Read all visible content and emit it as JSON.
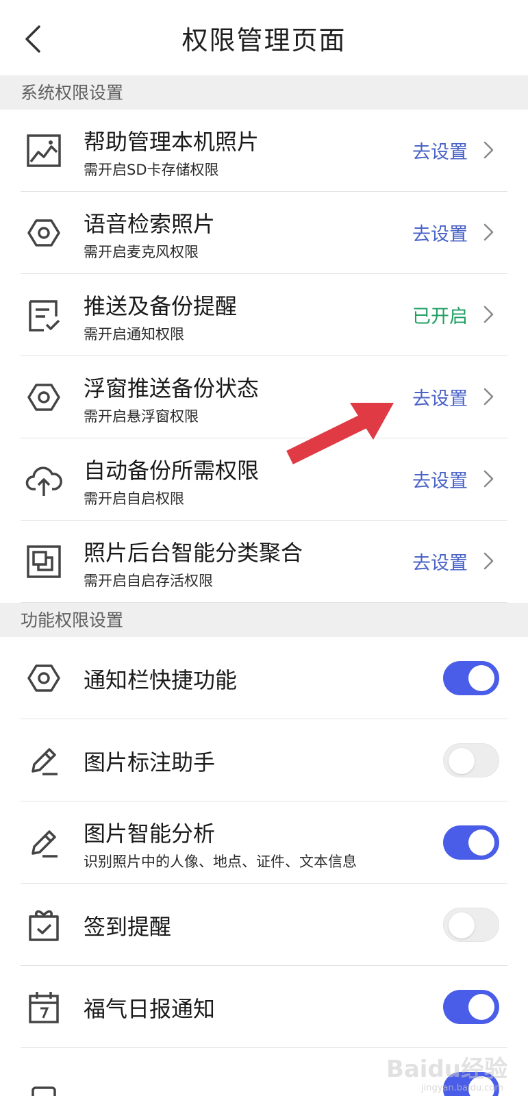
{
  "header": {
    "title": "权限管理页面"
  },
  "sections": {
    "system": "系统权限设置",
    "feature": "功能权限设置"
  },
  "system_items": [
    {
      "title": "帮助管理本机照片",
      "subtitle": "需开启SD卡存储权限",
      "action": "去设置",
      "icon": "image-icon"
    },
    {
      "title": "语音检索照片",
      "subtitle": "需开启麦克风权限",
      "action": "去设置",
      "icon": "hexagon-settings-icon"
    },
    {
      "title": "推送及备份提醒",
      "subtitle": "需开启通知权限",
      "action": "已开启",
      "icon": "checklist-icon"
    },
    {
      "title": "浮窗推送备份状态",
      "subtitle": "需开启悬浮窗权限",
      "action": "去设置",
      "icon": "hexagon-settings-icon"
    },
    {
      "title": "自动备份所需权限",
      "subtitle": "需开启自启权限",
      "action": "去设置",
      "icon": "cloud-upload-icon"
    },
    {
      "title": "照片后台智能分类聚合",
      "subtitle": "需开启自启存活权限",
      "action": "去设置",
      "icon": "layers-square-icon"
    }
  ],
  "feature_items": [
    {
      "title": "通知栏快捷功能",
      "subtitle": "",
      "enabled": true,
      "icon": "hexagon-settings-icon"
    },
    {
      "title": "图片标注助手",
      "subtitle": "",
      "enabled": false,
      "icon": "pencil-icon"
    },
    {
      "title": "图片智能分析",
      "subtitle": "识别照片中的人像、地点、证件、文本信息",
      "enabled": true,
      "icon": "pencil-icon"
    },
    {
      "title": "签到提醒",
      "subtitle": "",
      "enabled": false,
      "icon": "gift-check-icon"
    },
    {
      "title": "福气日报通知",
      "subtitle": "",
      "enabled": true,
      "icon": "calendar-icon"
    },
    {
      "title": "",
      "subtitle": "",
      "enabled": true,
      "icon": "generic-icon"
    }
  ],
  "watermark": {
    "text": "Baidu经验",
    "sub": "jingyan.baidu.com"
  },
  "colors": {
    "accent_blue": "#4a63c8",
    "toggle_on": "#4a5de8",
    "enabled_green": "#1e9e62",
    "arrow_red": "#e03a45"
  }
}
